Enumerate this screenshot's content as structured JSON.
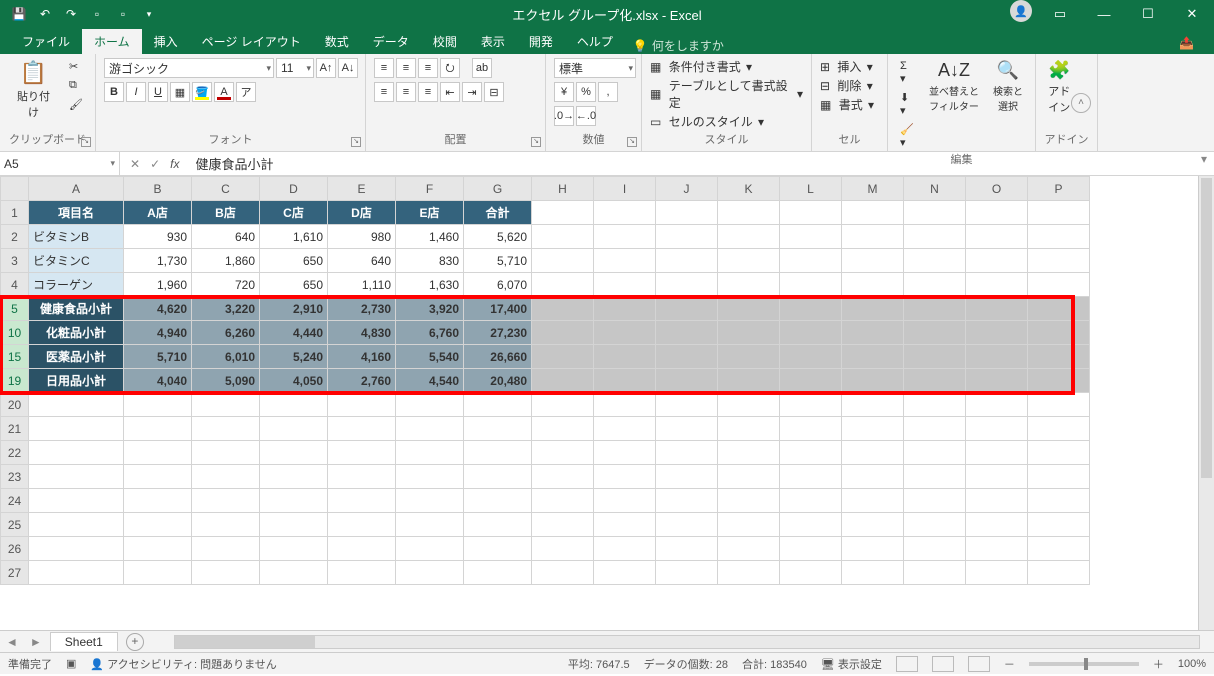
{
  "title": "エクセル グループ化.xlsx - Excel",
  "tabs": {
    "file": "ファイル",
    "home": "ホーム",
    "insert": "挿入",
    "layout": "ページ レイアウト",
    "formulas": "数式",
    "data": "データ",
    "review": "校閲",
    "view": "表示",
    "dev": "開発",
    "help": "ヘルプ",
    "tellme": "何をしますか"
  },
  "ribbon": {
    "clipboard": {
      "paste": "貼り付け",
      "label": "クリップボード"
    },
    "font": {
      "name": "游ゴシック",
      "size": "11",
      "label": "フォント"
    },
    "align": {
      "label": "配置"
    },
    "number": {
      "format": "標準",
      "label": "数値"
    },
    "styles": {
      "cond": "条件付き書式",
      "table": "テーブルとして書式設定",
      "cell": "セルのスタイル",
      "label": "スタイル"
    },
    "cells": {
      "insert": "挿入",
      "delete": "削除",
      "format": "書式",
      "label": "セル"
    },
    "editing": {
      "sort": "並べ替えと\nフィルター",
      "find": "検索と\n選択",
      "label": "編集"
    },
    "addin": {
      "addin": "アド\nイン",
      "label": "アドイン"
    }
  },
  "namebox": "A5",
  "formula": "健康食品小計",
  "columns": [
    "A",
    "B",
    "C",
    "D",
    "E",
    "F",
    "G",
    "H",
    "I",
    "J",
    "K",
    "L",
    "M",
    "N",
    "O",
    "P"
  ],
  "header_row": [
    "項目名",
    "A店",
    "B店",
    "C店",
    "D店",
    "E店",
    "合計"
  ],
  "rows": [
    {
      "n": "1",
      "type": "hdr"
    },
    {
      "n": "2",
      "type": "d",
      "cells": [
        "ビタミンB",
        "930",
        "640",
        "1,610",
        "980",
        "1,460",
        "5,620"
      ]
    },
    {
      "n": "3",
      "type": "d",
      "cells": [
        "ビタミンC",
        "1,730",
        "1,860",
        "650",
        "640",
        "830",
        "5,710"
      ]
    },
    {
      "n": "4",
      "type": "d",
      "cells": [
        "コラーゲン",
        "1,960",
        "720",
        "650",
        "1,110",
        "1,630",
        "6,070"
      ]
    },
    {
      "n": "5",
      "type": "s",
      "sel": true,
      "cells": [
        "健康食品小計",
        "4,620",
        "3,220",
        "2,910",
        "2,730",
        "3,920",
        "17,400"
      ]
    },
    {
      "n": "10",
      "type": "s",
      "sel": true,
      "cells": [
        "化粧品小計",
        "4,940",
        "6,260",
        "4,440",
        "4,830",
        "6,760",
        "27,230"
      ]
    },
    {
      "n": "15",
      "type": "s",
      "sel": true,
      "cells": [
        "医薬品小計",
        "5,710",
        "6,010",
        "5,240",
        "4,160",
        "5,540",
        "26,660"
      ]
    },
    {
      "n": "19",
      "type": "s",
      "sel": true,
      "cells": [
        "日用品小計",
        "4,040",
        "5,090",
        "4,050",
        "2,760",
        "4,540",
        "20,480"
      ]
    },
    {
      "n": "20",
      "type": "e"
    },
    {
      "n": "21",
      "type": "e"
    },
    {
      "n": "22",
      "type": "e"
    },
    {
      "n": "23",
      "type": "e"
    },
    {
      "n": "24",
      "type": "e"
    },
    {
      "n": "25",
      "type": "e"
    },
    {
      "n": "26",
      "type": "e"
    },
    {
      "n": "27",
      "type": "e"
    }
  ],
  "sheet_tab": "Sheet1",
  "status": {
    "ready": "準備完了",
    "acc": "アクセシビリティ: 問題ありません",
    "avg": "平均: 7647.5",
    "count": "データの個数: 28",
    "sum": "合計: 183540",
    "disp": "表示設定",
    "zoom": "100%"
  },
  "colwidths": {
    "A": 95,
    "B": 68,
    "C": 68,
    "D": 68,
    "E": 68,
    "F": 68,
    "G": 68,
    "rest": 62
  }
}
